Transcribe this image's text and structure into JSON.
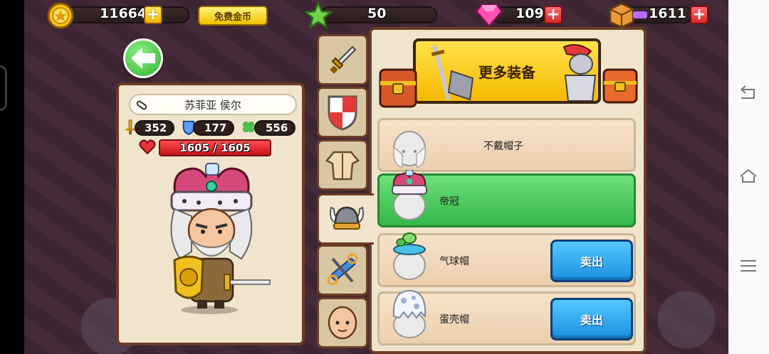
{
  "resources": {
    "gold": "11664",
    "free_gold_label": "免费金币",
    "stars": "50",
    "gems": "109",
    "boxes": "1611"
  },
  "character": {
    "name": "苏菲亚 侯尔",
    "attack": "352",
    "defense": "177",
    "luck": "556",
    "hp": "1605 / 1605"
  },
  "tabs": [
    {
      "icon": "sword-icon"
    },
    {
      "icon": "shield-icon"
    },
    {
      "icon": "armor-icon"
    },
    {
      "icon": "viking-helmet-icon"
    },
    {
      "icon": "scissors-comb-icon"
    },
    {
      "icon": "face-icon"
    }
  ],
  "equipment": {
    "more_label": "更多装备",
    "items": [
      {
        "label": "不戴帽子",
        "selected": false
      },
      {
        "label": "帝冠",
        "selected": true
      },
      {
        "label": "气球帽",
        "selected": false,
        "sell_label": "卖出"
      },
      {
        "label": "蛋壳帽",
        "selected": false,
        "sell_label": "卖出"
      }
    ]
  },
  "colors": {
    "panel": "#f0e5cc",
    "border": "#6b3c24",
    "selected_row": "#4ccb5e",
    "sell_button": "#2aa6f0"
  }
}
